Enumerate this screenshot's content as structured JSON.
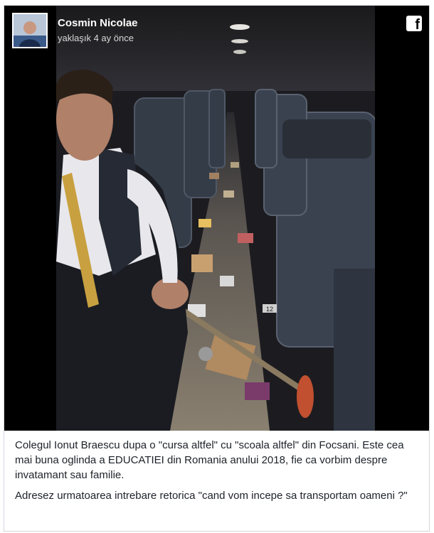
{
  "post": {
    "author": "Cosmin Nicolae",
    "time": "yaklaşık 4 ay önce",
    "icon": "facebook-icon",
    "paragraphs": [
      "Colegul Ionut Braescu dupa o \"cursa altfel\" cu \"scoala altfel\" din Focsani. Este cea mai buna oglinda a EDUCATIEI din Romania anului 2018, fie ca vorbim despre invatamant sau familie.",
      "Adresez urmatoarea intrebare retorica \"cand vom incepe sa transportam oameni ?\""
    ]
  },
  "photo": {
    "seat_labels": [
      "12"
    ]
  }
}
